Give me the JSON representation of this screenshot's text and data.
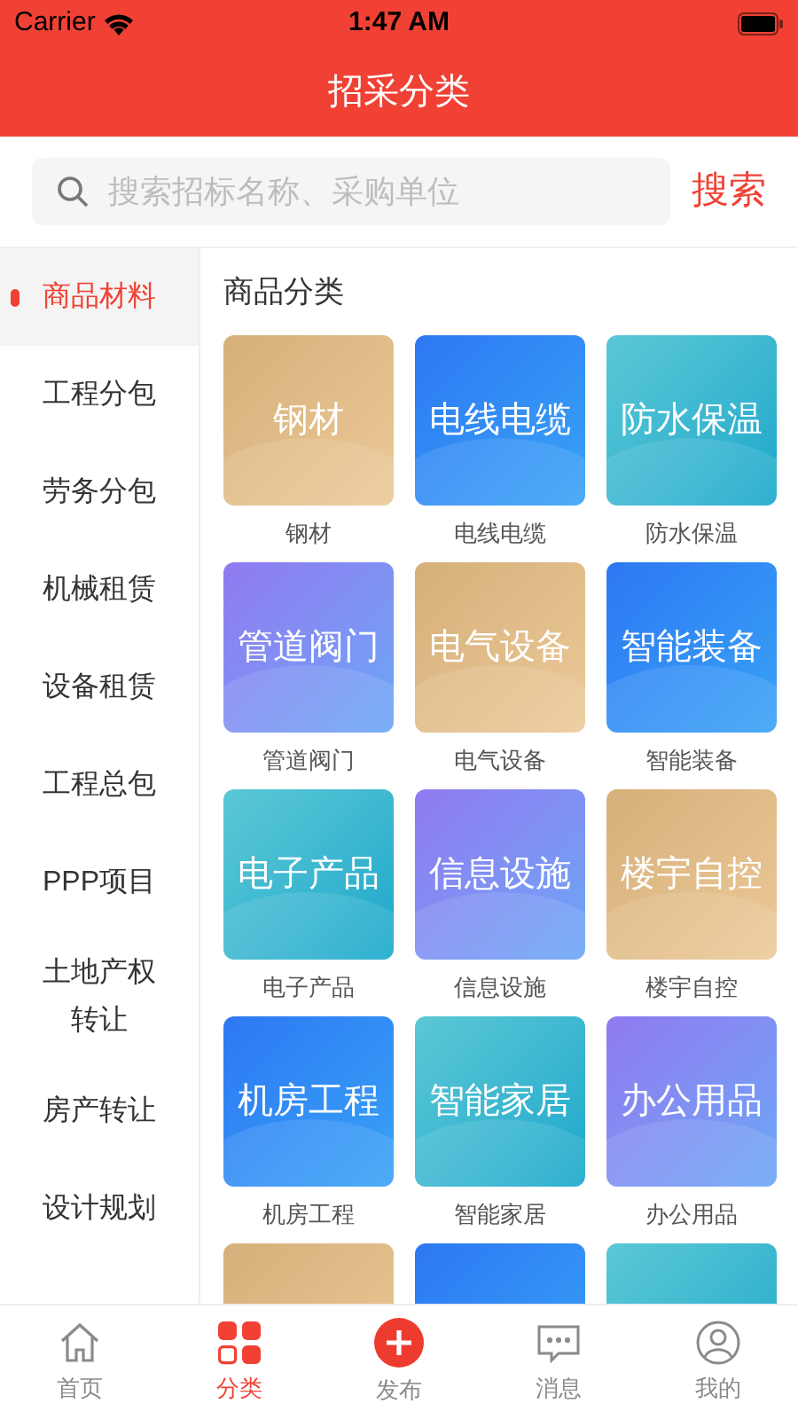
{
  "status_bar": {
    "carrier": "Carrier",
    "time": "1:47 AM"
  },
  "header": {
    "title": "招采分类"
  },
  "search": {
    "placeholder": "搜索招标名称、采购单位",
    "button": "搜索"
  },
  "sidebar": {
    "items": [
      {
        "label": "商品材料",
        "selected": true
      },
      {
        "label": "工程分包",
        "selected": false
      },
      {
        "label": "劳务分包",
        "selected": false
      },
      {
        "label": "机械租赁",
        "selected": false
      },
      {
        "label": "设备租赁",
        "selected": false
      },
      {
        "label": "工程总包",
        "selected": false
      },
      {
        "label": "PPP项目",
        "selected": false
      },
      {
        "label": "土地产权转让",
        "selected": false
      },
      {
        "label": "房产转让",
        "selected": false
      },
      {
        "label": "设计规划",
        "selected": false
      }
    ]
  },
  "content": {
    "title": "商品分类",
    "tiles": [
      {
        "label": "钢材",
        "caption": "钢材",
        "kind": "gold"
      },
      {
        "label": "电线电缆",
        "caption": "电线电缆",
        "kind": "blue"
      },
      {
        "label": "防水保温",
        "caption": "防水保温",
        "kind": "teal"
      },
      {
        "label": "管道阀门",
        "caption": "管道阀门",
        "kind": "purple"
      },
      {
        "label": "电气设备",
        "caption": "电气设备",
        "kind": "gold"
      },
      {
        "label": "智能装备",
        "caption": "智能装备",
        "kind": "blue"
      },
      {
        "label": "电子产品",
        "caption": "电子产品",
        "kind": "teal"
      },
      {
        "label": "信息设施",
        "caption": "信息设施",
        "kind": "purple"
      },
      {
        "label": "楼宇自控",
        "caption": "楼宇自控",
        "kind": "gold"
      },
      {
        "label": "机房工程",
        "caption": "机房工程",
        "kind": "blue"
      },
      {
        "label": "智能家居",
        "caption": "智能家居",
        "kind": "teal"
      },
      {
        "label": "办公用品",
        "caption": "办公用品",
        "kind": "purple"
      },
      {
        "kind": "gold"
      },
      {
        "kind": "blue"
      },
      {
        "kind": "teal"
      }
    ]
  },
  "tab_bar": [
    {
      "label": "首页",
      "kind": "home",
      "selected": false
    },
    {
      "label": "分类",
      "kind": "grid",
      "selected": true
    },
    {
      "label": "发布",
      "kind": "plus",
      "selected": false
    },
    {
      "label": "消息",
      "kind": "chat",
      "selected": false
    },
    {
      "label": "我的",
      "kind": "user",
      "selected": false
    }
  ]
}
